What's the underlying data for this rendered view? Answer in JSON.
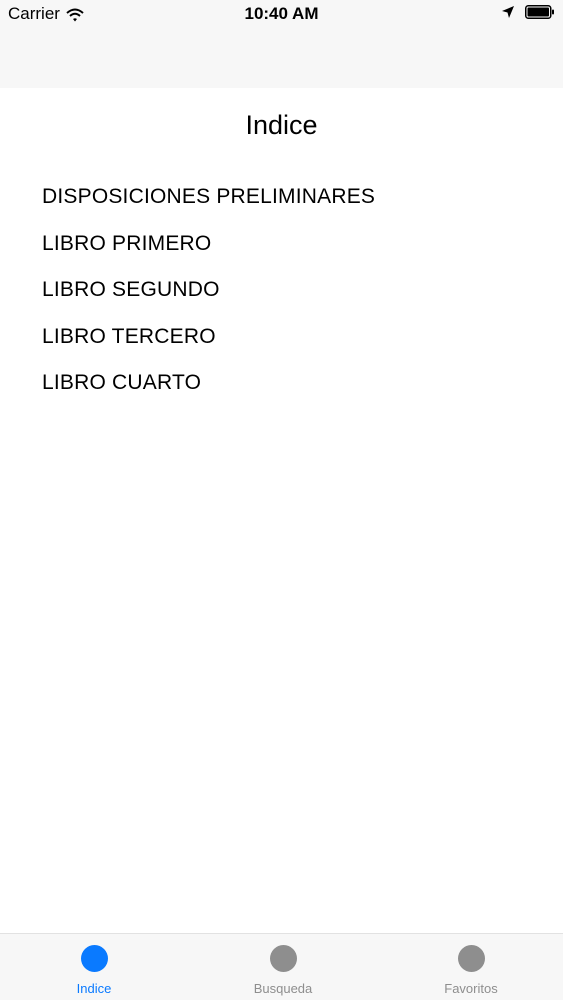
{
  "status_bar": {
    "carrier": "Carrier",
    "time": "10:40 AM"
  },
  "page": {
    "title": "Indice"
  },
  "index_items": [
    "DISPOSICIONES PRELIMINARES",
    "LIBRO PRIMERO",
    "LIBRO SEGUNDO",
    "LIBRO TERCERO",
    "LIBRO CUARTO"
  ],
  "tab_bar": {
    "tabs": [
      {
        "label": "Indice",
        "active": true
      },
      {
        "label": "Busqueda",
        "active": false
      },
      {
        "label": "Favoritos",
        "active": false
      }
    ]
  },
  "colors": {
    "accent": "#0a7aff",
    "inactive": "#8e8e8e",
    "bar_background": "#f7f7f7"
  },
  "icons": [
    "wifi-icon",
    "location-arrow-icon",
    "battery-icon",
    "tab-circle-icon"
  ]
}
